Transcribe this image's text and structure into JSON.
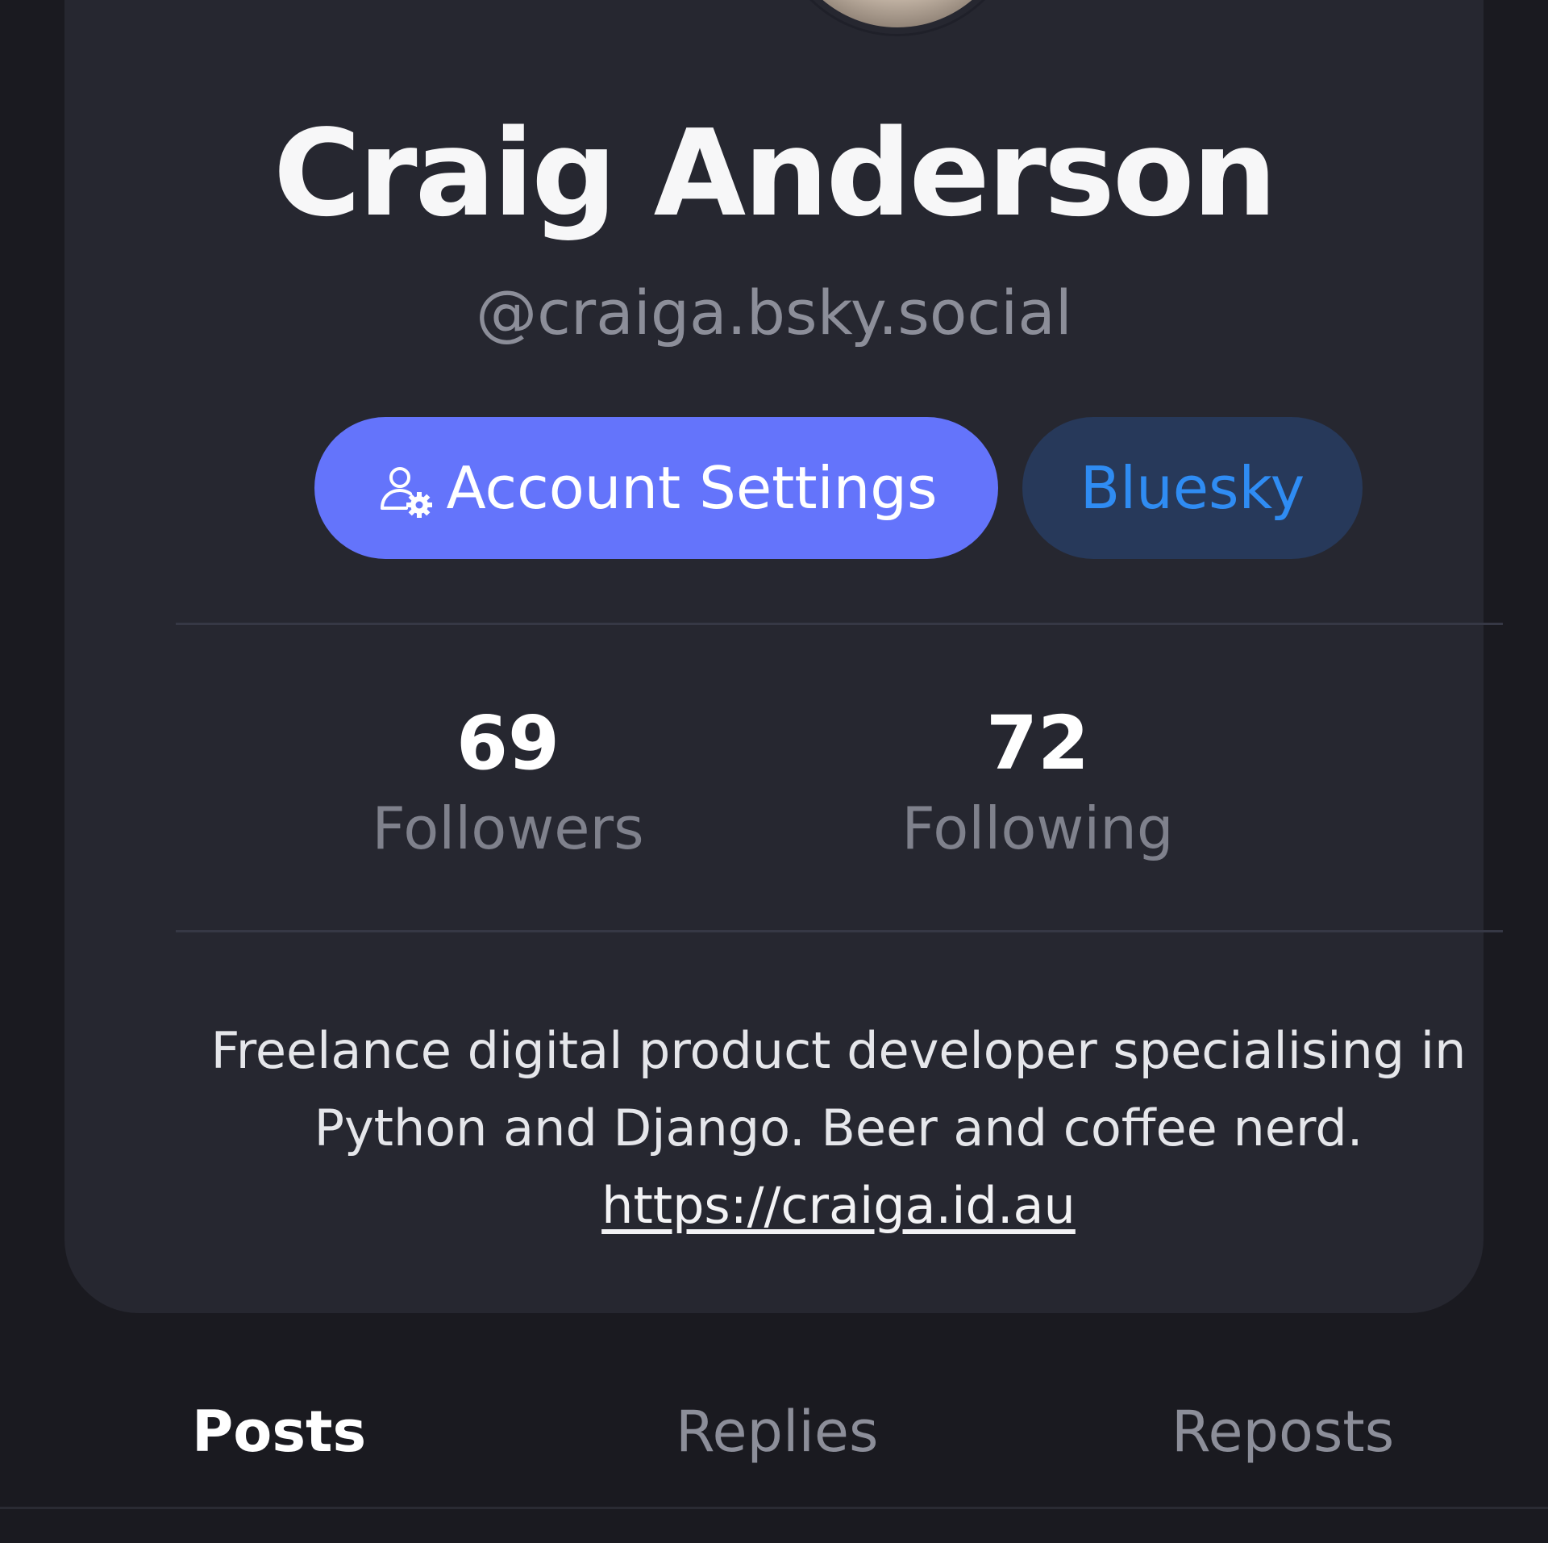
{
  "profile": {
    "name": "Craig Anderson",
    "handle": "@craiga.bsky.social",
    "bio_text": "Freelance digital product developer specialising in Python and Django. Beer and coffee nerd.",
    "bio_link": "https://craiga.id.au"
  },
  "buttons": {
    "account_settings": "Account Settings",
    "bluesky": "Bluesky"
  },
  "stats": {
    "followers_count": "69",
    "followers_label": "Followers",
    "following_count": "72",
    "following_label": "Following"
  },
  "tabs": [
    {
      "label": "Posts",
      "active": true
    },
    {
      "label": "Replies",
      "active": false
    },
    {
      "label": "Reposts",
      "active": false
    }
  ],
  "colors": {
    "page_bg": "#1a1a20",
    "card_bg": "#262730",
    "primary_button": "#6474fb",
    "secondary_button_bg": "#27395a",
    "secondary_button_text": "#2f8cf3"
  },
  "icons": {
    "account_settings_icon": "user-gear-icon"
  }
}
